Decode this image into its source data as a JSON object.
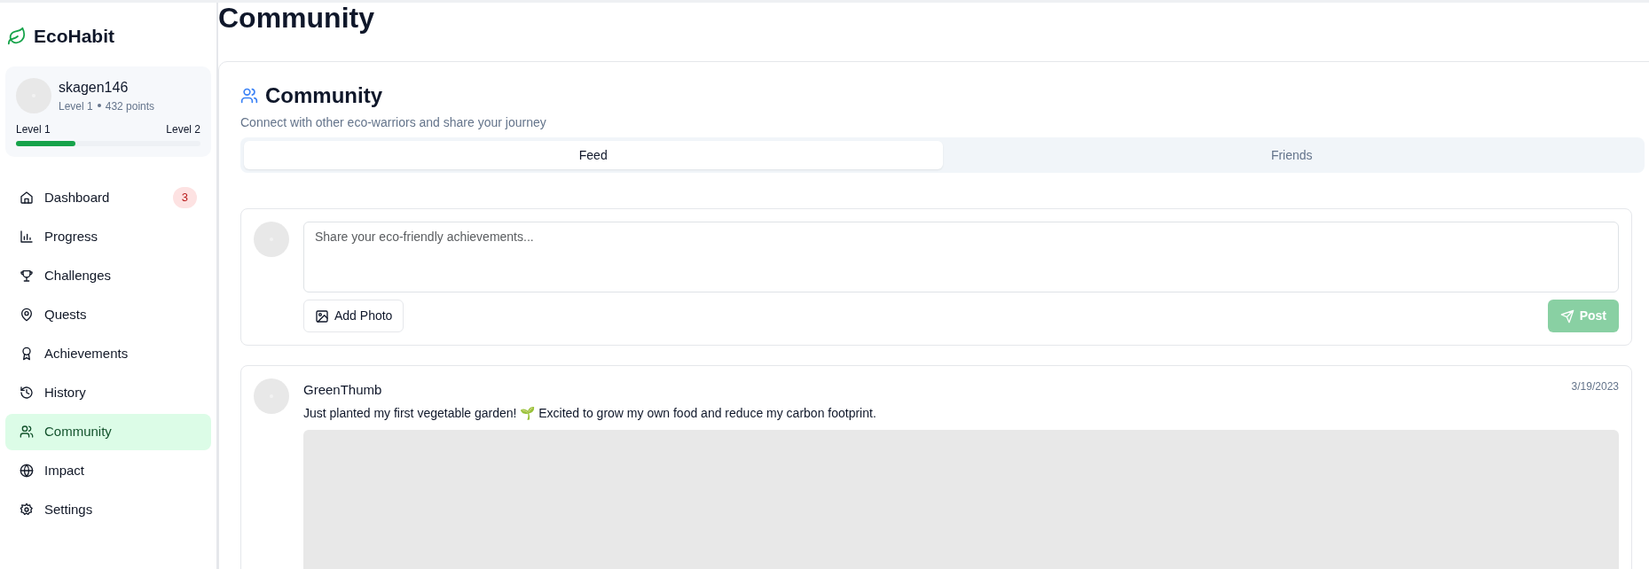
{
  "brand": {
    "name": "EcoHabit"
  },
  "user": {
    "name": "skagen146",
    "level_text": "Level 1",
    "points_text": "432 points",
    "current_level": "Level 1",
    "next_level": "Level 2",
    "level": 0.32
  },
  "nav": [
    {
      "label": "Dashboard",
      "selected": false,
      "badge": "3"
    },
    {
      "label": "Progress",
      "selected": false
    },
    {
      "label": "Challenges",
      "selected": false
    },
    {
      "label": "Quests",
      "selected": false
    },
    {
      "label": "Achievements",
      "selected": false
    },
    {
      "label": "History",
      "selected": false
    },
    {
      "label": "Community",
      "selected": true
    },
    {
      "label": "Impact",
      "selected": false
    },
    {
      "label": "Settings",
      "selected": false
    }
  ],
  "page_title": "Community",
  "card": {
    "title": "Community",
    "subtitle": "Connect with other eco-warriors and share your journey"
  },
  "tabs": [
    {
      "label": "Feed",
      "selected": true
    },
    {
      "label": "Friends",
      "selected": false
    }
  ],
  "composer": {
    "placeholder": "Share your eco-friendly achievements...",
    "add_photo": "Add Photo",
    "post": "Post",
    "post_disabled": true
  },
  "posts": [
    {
      "author": "GreenThumb",
      "date": "3/19/2023",
      "text": "Just planted my first vegetable garden! 🌱 Excited to grow my own food and reduce my carbon footprint.",
      "kind": "picture"
    }
  ]
}
